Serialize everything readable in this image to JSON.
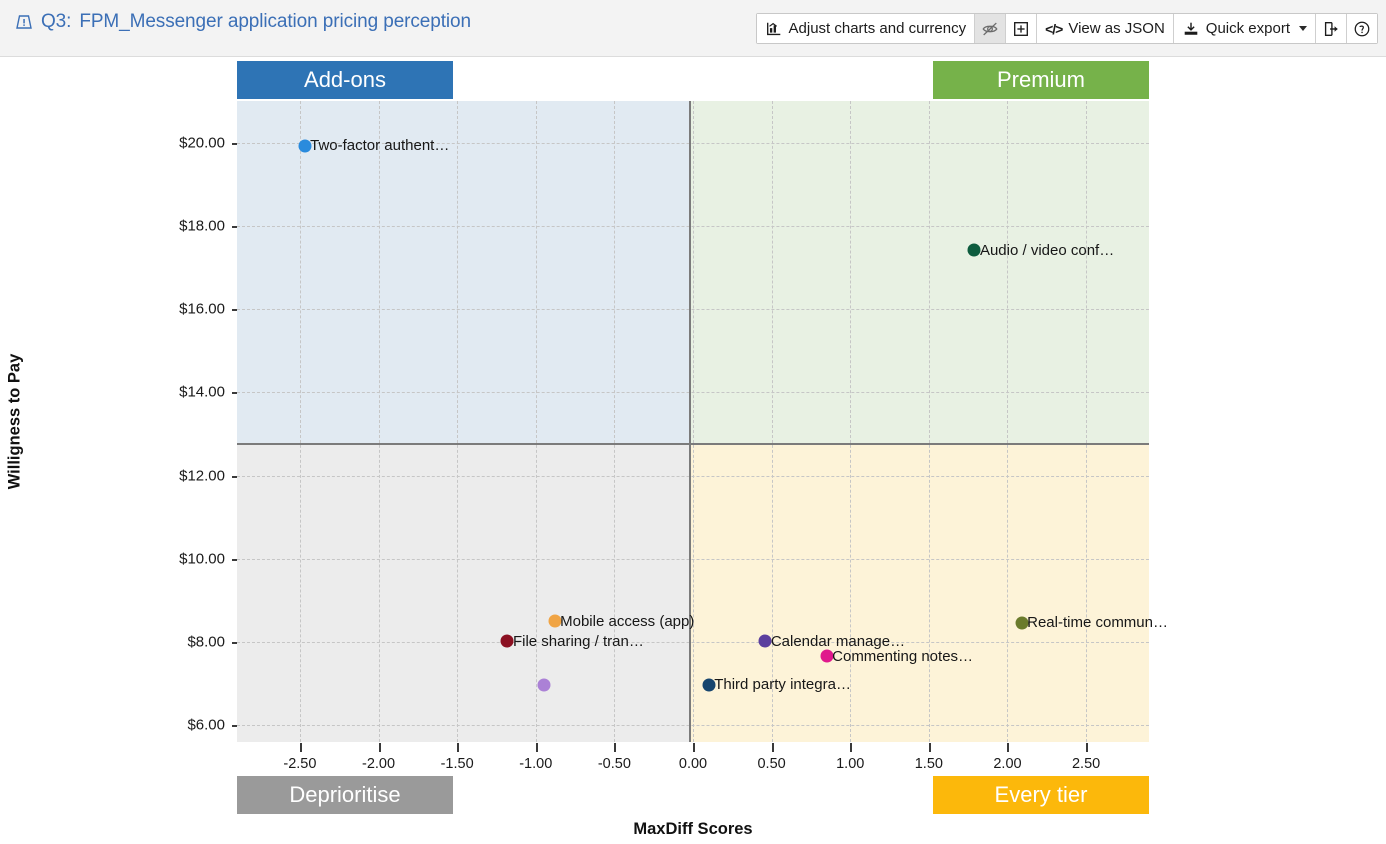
{
  "header": {
    "warning_icon": "warning-icon",
    "question_id": "Q3:",
    "title": "FPM_Messenger application pricing perception",
    "toolbar": {
      "adjust": {
        "label": "Adjust charts and currency",
        "icon": "chart-icon"
      },
      "hide": {
        "label": "",
        "icon": "eye-off-icon"
      },
      "expand": {
        "label": "",
        "icon": "expand-plus-icon"
      },
      "json": {
        "label": "View as JSON",
        "icon": "code-icon"
      },
      "export": {
        "label": "Quick export",
        "icon": "download-icon"
      },
      "share": {
        "label": "",
        "icon": "export-arrow-icon"
      },
      "help": {
        "label": "",
        "icon": "help-circle-icon"
      }
    }
  },
  "quadrant_labels": {
    "top_left": "Add-ons",
    "top_right": "Premium",
    "bottom_left": "Deprioritise",
    "bottom_right": "Every tier"
  },
  "colors": {
    "accent_blue": "#3b6fb6",
    "addons": "#2e74b5",
    "premium": "#76b24a",
    "deprioritise": "#9a9a9a",
    "every_tier": "#fcb80b",
    "quad_tl_bg": "#e1eaf2",
    "quad_tr_bg": "#e8f1e3",
    "quad_bl_bg": "#ececec",
    "quad_br_bg": "#fdf3d8"
  },
  "chart_data": {
    "type": "scatter",
    "title": "FPM_Messenger application pricing perception",
    "xlabel": "MaxDiff Scores",
    "ylabel": "Willigness to Pay",
    "xlim": [
      -2.9,
      2.9
    ],
    "ylim": [
      5.6,
      21.0
    ],
    "xticks": [
      "-2.50",
      "-2.00",
      "-1.50",
      "-1.00",
      "-0.50",
      "0.00",
      "0.50",
      "1.00",
      "1.50",
      "2.00",
      "2.50"
    ],
    "xtick_values": [
      -2.5,
      -2.0,
      -1.5,
      -1.0,
      -0.5,
      0.0,
      0.5,
      1.0,
      1.5,
      2.0,
      2.5
    ],
    "yticks": [
      "$20.00",
      "$18.00",
      "$16.00",
      "$14.00",
      "$12.00",
      "$10.00",
      "$8.00",
      "$6.00"
    ],
    "ytick_values": [
      20,
      18,
      16,
      14,
      12,
      10,
      8,
      6
    ],
    "grid": true,
    "legend": "none",
    "quadrant_divider_x": 0.0,
    "quadrant_divider_y": 13.0,
    "points": [
      {
        "label": "Two-factor authent…",
        "x": -2.47,
        "y": 19.93,
        "color": "#2a8bdd",
        "label_visible": true
      },
      {
        "label": "Audio / video conf…",
        "x": 1.79,
        "y": 17.42,
        "color": "#0d5c3e",
        "label_visible": true
      },
      {
        "label": "Mobile access (app)",
        "x": -0.88,
        "y": 8.5,
        "color": "#f0a444",
        "label_visible": true
      },
      {
        "label": "Real-time commun…",
        "x": 2.09,
        "y": 8.47,
        "color": "#6b7b2c",
        "label_visible": true
      },
      {
        "label": "File sharing / tran…",
        "x": -1.18,
        "y": 8.02,
        "color": "#8b1021",
        "label_visible": true
      },
      {
        "label": "Calendar manage…",
        "x": 0.46,
        "y": 8.02,
        "color": "#5b3f9e",
        "label_visible": true
      },
      {
        "label": "Commenting notes…",
        "x": 0.85,
        "y": 7.66,
        "color": "#e0198c",
        "label_visible": true
      },
      {
        "label": "Third party integra…",
        "x": 0.1,
        "y": 6.97,
        "color": "#17456e",
        "label_visible": true
      },
      {
        "label": "",
        "x": -0.95,
        "y": 6.97,
        "color": "#ab81d6",
        "label_visible": false
      }
    ]
  }
}
